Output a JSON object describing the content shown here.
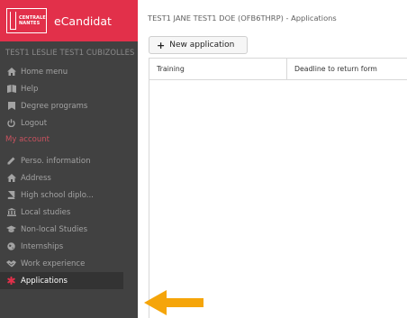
{
  "brand": {
    "logo_line1": "CENTRALE",
    "logo_line2": "NANTES",
    "title": "eCandidat"
  },
  "sidebar": {
    "user": "TEST1 LESLIE TEST1 CUBIZOLLES",
    "main_items": [
      {
        "label": "Home menu",
        "icon": "home-icon"
      },
      {
        "label": "Help",
        "icon": "book-icon"
      },
      {
        "label": "Degree programs",
        "icon": "bookmark-icon"
      },
      {
        "label": "Logout",
        "icon": "power-icon"
      }
    ],
    "account_section": "My account",
    "account_items": [
      {
        "label": "Perso. information",
        "icon": "pencil-icon"
      },
      {
        "label": "Address",
        "icon": "home-icon"
      },
      {
        "label": "High school diplo...",
        "icon": "book-icon"
      },
      {
        "label": "Local studies",
        "icon": "bank-icon"
      },
      {
        "label": "Non-local Studies",
        "icon": "graduation-cap-icon"
      },
      {
        "label": "Internships",
        "icon": "globe-icon"
      },
      {
        "label": "Work experience",
        "icon": "handshake-icon"
      },
      {
        "label": "Applications",
        "icon": "asterisk-icon",
        "active": true
      }
    ],
    "accent_color": "#e2304a",
    "background_color": "#414141"
  },
  "main": {
    "title": "TEST1 JANE TEST1 DOE (OFB6THRP) - Applications",
    "new_button_label": "New application",
    "table": {
      "columns": [
        "Training",
        "Deadline to return form"
      ],
      "rows": []
    }
  },
  "annotation": {
    "arrow_color": "#f5a50a",
    "points_to": "Applications"
  }
}
